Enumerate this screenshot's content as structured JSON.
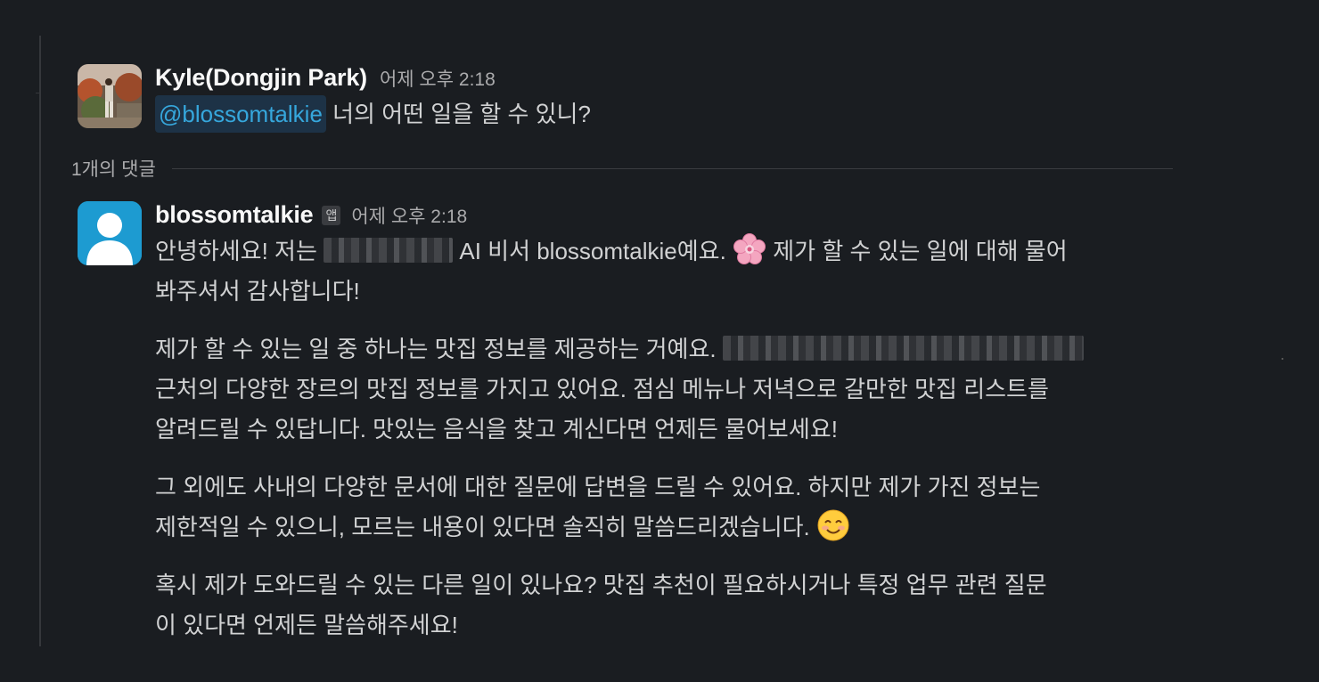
{
  "thread": {
    "parent": {
      "sender": "Kyle(Dongjin Park)",
      "timestamp": "어제 오후 2:18",
      "mention": "@blossomtalkie",
      "text": "너의 어떤 일을 할 수 있니?"
    },
    "reply_count_label": "1개의 댓글",
    "reply": {
      "sender": "blossomtalkie",
      "app_badge": "앱",
      "timestamp": "어제 오후 2:18",
      "p1_a": "안녕하세요! 저는",
      "p1_b": "AI 비서 blossomtalkie예요.",
      "p1_c": "제가 할 수 있는 일에 대해 물어",
      "p1_d": "봐주셔서 감사합니다!",
      "p2_a": "제가 할 수 있는 일 중 하나는 맛집 정보를 제공하는 거예요.",
      "p2_b": "근처의 다양한 장르의 맛집 정보를 가지고 있어요. 점심 메뉴나 저녁으로 갈만한 맛집 리스트를",
      "p2_c": "알려드릴 수 있답니다. 맛있는 음식을 찾고 계신다면 언제든 물어보세요!",
      "p3_a": "그 외에도 사내의 다양한 문서에 대한 질문에 답변을 드릴 수 있어요. 하지만 제가 가진 정보는",
      "p3_b": "제한적일 수 있으니, 모르는 내용이 있다면 솔직히 말씀드리겠습니다.",
      "p4_a": "혹시 제가 도와드릴 수 있는 다른 일이 있나요? 맛집 추천이 필요하시거나 특정 업무 관련 질문",
      "p4_b": "이 있다면 언제든 말씀해주세요!"
    }
  },
  "icons": {
    "parent_avatar": "user-photo-avatar",
    "reply_avatar": "default-person-avatar",
    "emoji_1": "cherry-blossom-emoji",
    "emoji_2": "smiling-face-emoji"
  },
  "colors": {
    "background": "#1a1d21",
    "mention_text": "#36a7dc",
    "mention_bg": "#1d3246",
    "default_avatar_bg": "#1d9bd1"
  }
}
